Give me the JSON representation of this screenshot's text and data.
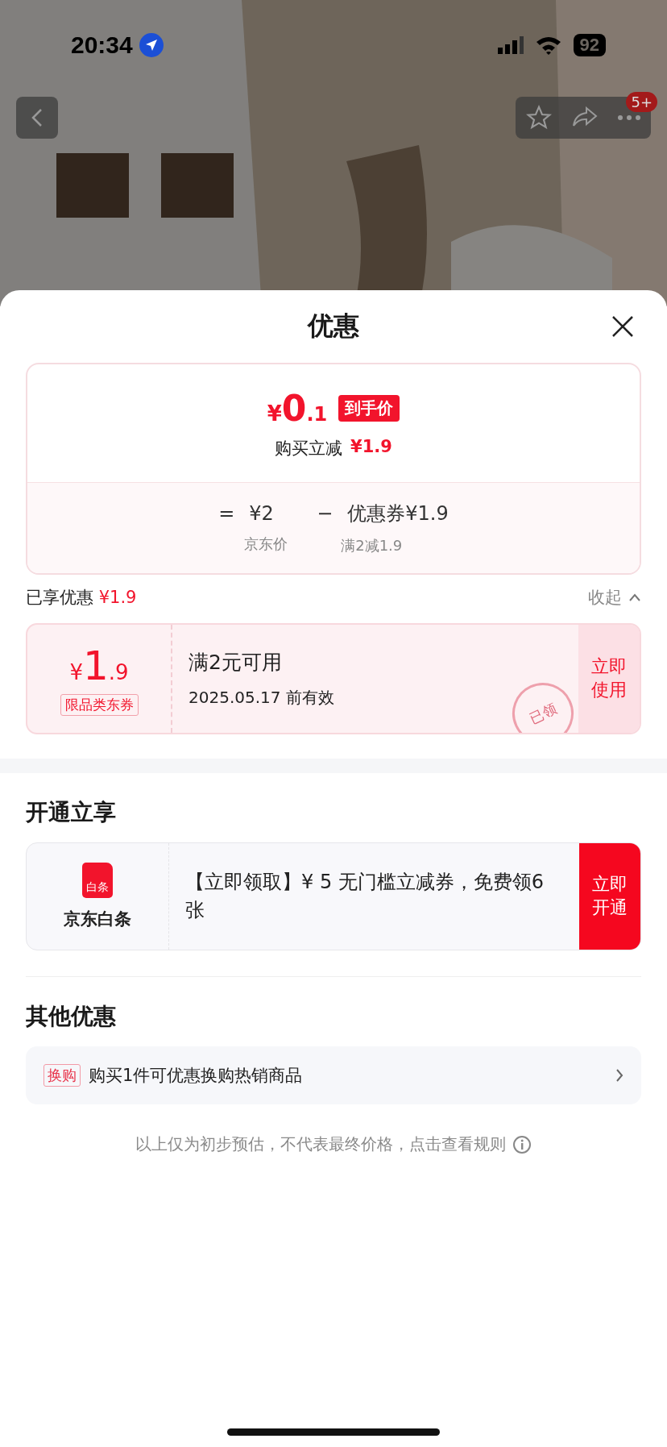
{
  "status_bar": {
    "time": "20:34",
    "battery": "92"
  },
  "nav": {
    "cart_badge": "5+"
  },
  "sheet": {
    "title": "优惠",
    "price_card": {
      "currency": "¥",
      "price_int": "0",
      "price_dec": ".1",
      "price_tag": "到手价",
      "saving_label": "购买立减",
      "saving_amount": "¥1.9",
      "breakdown": [
        {
          "kind": "equals",
          "op": "=",
          "value": "¥2",
          "caption": "京东价"
        },
        {
          "kind": "minus",
          "op": "−",
          "value": "优惠券¥1.9",
          "caption": "满2减1.9"
        }
      ]
    },
    "enjoyed": {
      "label": "已享优惠",
      "amount": "¥1.9",
      "toggle": "收起",
      "expanded": true
    },
    "coupons": [
      {
        "currency": "¥",
        "amount_int": "1",
        "amount_dec": ".9",
        "type": "限品类东券",
        "condition": "满2元可用",
        "validity": "2025.05.17 前有效",
        "action": "立即使用",
        "stamp": "已领"
      }
    ],
    "open_section": {
      "title": "开通立享",
      "card": {
        "badge": "白条",
        "name": "京东白条",
        "text": "【立即领取】¥ 5 无门槛立减券，免费领6张",
        "action": "立即开通"
      }
    },
    "other_section": {
      "title": "其他优惠",
      "items": [
        {
          "tag": "换购",
          "text": "购买1件可优惠换购热销商品"
        }
      ]
    },
    "disclaimer": "以上仅为初步预估，不代表最终价格，点击查看规则"
  }
}
